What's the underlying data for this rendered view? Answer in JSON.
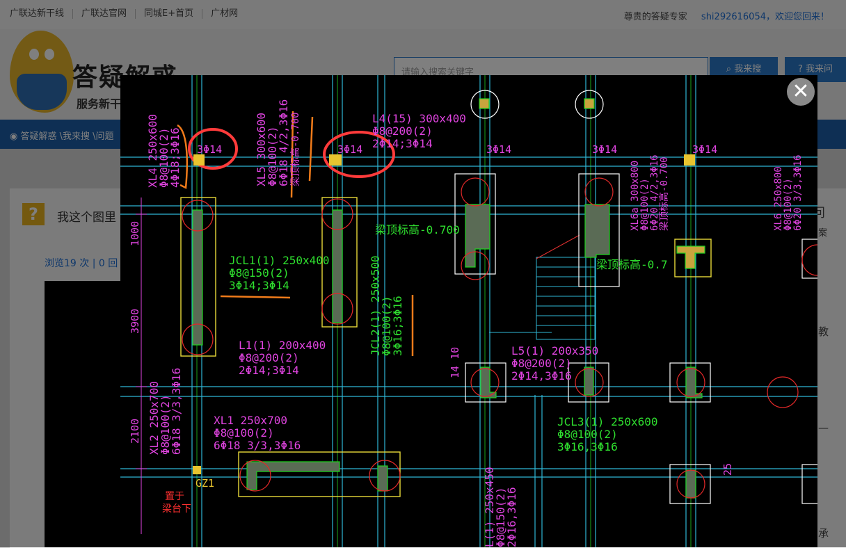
{
  "top_links": [
    "广联达新干线",
    "广联达官网",
    "同城E+首页",
    "广材网"
  ],
  "user": {
    "greeting": "尊贵的答疑专家",
    "name_text": "shi292616054，欢迎您回来！"
  },
  "brand": {
    "title": "答疑解惑",
    "subtitle": "服务新干"
  },
  "search": {
    "placeholder": "请输入搜索关键字",
    "search_label": "我来搜",
    "ask_label": "我来问"
  },
  "breadcrumb": "答疑解惑 \\我来搜 \\问题",
  "question": {
    "title": "我这个图里",
    "stats": "浏览19 次 | 0 回"
  },
  "right_fragments": [
    "问",
    "案",
    "教",
    "—",
    "承"
  ],
  "close_label": "✕",
  "drawing": {
    "labels_magenta": [
      "XL4 250x600",
      "Φ8@100(2)",
      "4Φ18;3Φ16",
      "XL5 300x600",
      "Φ8@100(2)",
      "6Φ18 4/2,3Φ16",
      "梁顶标高-0.700",
      "L4(15) 300x400",
      "Φ8@200(2)",
      "2Φ14;3Φ14",
      "L1(1) 200x400",
      "Φ8@200(2)",
      "2Φ14;3Φ14",
      "XL1 250x700",
      "Φ8@100(2)",
      "6Φ18 3/3,3Φ16",
      "XL2 250x700",
      "Φ8@100(2)",
      "6Φ18 3/3,3Φ16",
      "L5(1) 200x350",
      "Φ8@200(2)",
      "2Φ14,3Φ16",
      "XL6a 300x800",
      "Φ8@100(2)",
      "6Φ20 4/2,3Φ16",
      "梁顶标高-0.700",
      "XL6 250x800",
      "Φ8@100(2)",
      "6Φ20 3/3,3Φ16",
      "L(1) 250x450",
      "Φ8@150(2)",
      "2Φ16,3Φ16"
    ],
    "labels_green": [
      "JCL1(1) 250x400",
      "Φ8@150(2)",
      "3Φ14;3Φ14",
      "JCL2(1) 250x500",
      "Φ8@100(2)",
      "3Φ16;3Φ16",
      "梁顶标高-0.700",
      "梁顶标高-0.7",
      "JCL3(1) 250x600",
      "Φ8@100(2)",
      "3Φ16,3Φ16"
    ],
    "rebar_marks": [
      "3Φ14",
      "3Φ14",
      "3Φ14",
      "3Φ14",
      "3Φ14"
    ],
    "dims": [
      "1000",
      "3900",
      "2100",
      "14 10",
      "25"
    ],
    "gz_label": "GZ1",
    "note_red": [
      "置于",
      "梁台下"
    ]
  }
}
